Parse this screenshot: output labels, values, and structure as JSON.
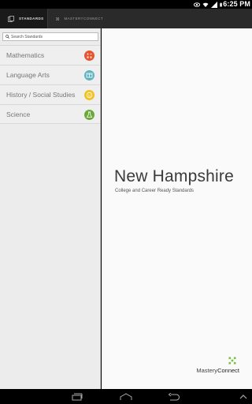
{
  "status_bar": {
    "time": "6:25 PM",
    "icons": [
      "eye-icon",
      "wifi-icon",
      "signal-icon",
      "battery-icon"
    ]
  },
  "tabs": [
    {
      "label": "STANDARDS",
      "icon": "standards-icon",
      "active": true
    },
    {
      "label": "MASTERYCONNECT",
      "icon": "masteryconnect-icon",
      "active": false
    }
  ],
  "search": {
    "placeholder": "Search Standards",
    "value": ""
  },
  "subjects": [
    {
      "label": "Mathematics",
      "icon": "math-icon",
      "color": "#e5532f"
    },
    {
      "label": "Language Arts",
      "icon": "book-icon",
      "color": "#5fb3c0"
    },
    {
      "label": "History / Social Studies",
      "icon": "smiley-icon",
      "color": "#f1c21b"
    },
    {
      "label": "Science",
      "icon": "flask-icon",
      "color": "#6aa93a"
    }
  ],
  "main": {
    "title": "New Hampshire",
    "subtitle": "College and Career Ready Standards"
  },
  "logo": {
    "part1": "Mastery",
    "part2": "Connect",
    "accent": "#7cbf3f"
  },
  "navbar": {
    "icons": [
      "recent-apps-icon",
      "home-icon",
      "back-icon",
      "up-icon"
    ]
  }
}
